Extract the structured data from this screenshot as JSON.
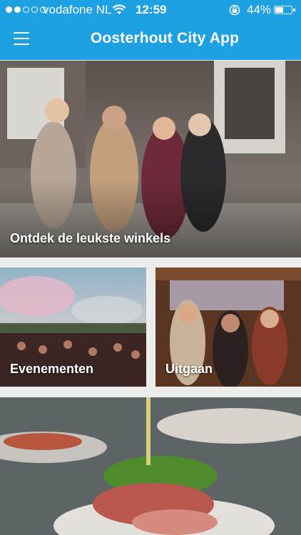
{
  "status_bar": {
    "carrier": "vodafone NL",
    "time": "12:59",
    "battery_percent": "44%",
    "battery_level": 0.44,
    "signal_bars": 2
  },
  "header": {
    "title": "Oosterhout City App",
    "menu_icon": "hamburger-menu-icon",
    "background_color": "#1ea1e3"
  },
  "tiles": [
    {
      "label": "Ontdek de leukste winkels"
    },
    {
      "label": "Evenementen"
    },
    {
      "label": "Uitgaan"
    },
    {
      "label": ""
    }
  ]
}
